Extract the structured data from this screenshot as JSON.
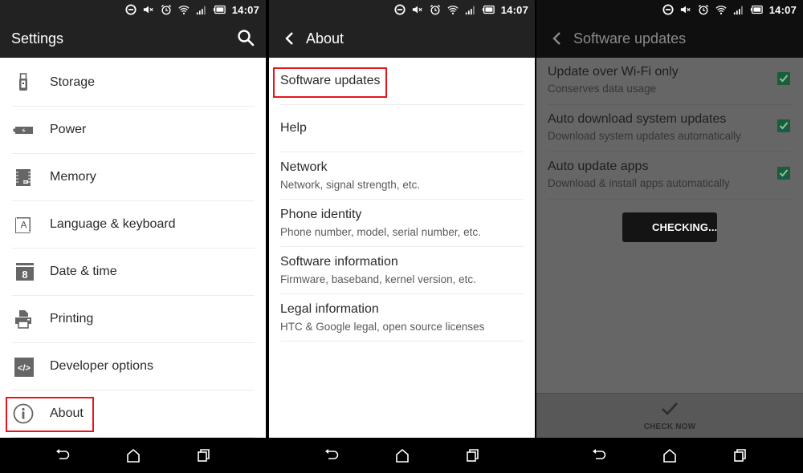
{
  "status_bar": {
    "time": "14:07",
    "icons": [
      "do-not-disturb-icon",
      "mute-icon",
      "alarm-icon",
      "wifi-icon",
      "signal-icon",
      "battery-icon"
    ]
  },
  "settings_screen": {
    "title": "Settings",
    "search_icon": "search-icon",
    "items": [
      {
        "label": "Storage",
        "icon": "usb-storage-icon"
      },
      {
        "label": "Power",
        "icon": "battery-power-icon"
      },
      {
        "label": "Memory",
        "icon": "memory-chip-icon"
      },
      {
        "label": "Language & keyboard",
        "icon": "language-keyboard-icon"
      },
      {
        "label": "Date & time",
        "icon": "calendar-icon",
        "icon_text": "8"
      },
      {
        "label": "Printing",
        "icon": "printer-icon"
      },
      {
        "label": "Developer options",
        "icon": "code-icon",
        "icon_text": "</>"
      },
      {
        "label": "About",
        "icon": "info-icon",
        "highlighted": true
      }
    ]
  },
  "about_screen": {
    "title": "About",
    "items": [
      {
        "title": "Software updates",
        "subtitle": "",
        "highlighted": true
      },
      {
        "title": "Help",
        "subtitle": ""
      },
      {
        "title": "Network",
        "subtitle": "Network, signal strength, etc."
      },
      {
        "title": "Phone identity",
        "subtitle": "Phone number, model, serial number, etc."
      },
      {
        "title": "Software information",
        "subtitle": "Firmware, baseband, kernel version, etc."
      },
      {
        "title": "Legal information",
        "subtitle": "HTC & Google legal, open source licenses"
      }
    ]
  },
  "software_updates_screen": {
    "title": "Software updates",
    "items": [
      {
        "title": "Update over Wi-Fi only",
        "subtitle": "Conserves data usage",
        "checked": true
      },
      {
        "title": "Auto download system updates",
        "subtitle": "Download system updates automatically",
        "checked": true
      },
      {
        "title": "Auto update apps",
        "subtitle": "Download & install apps automatically",
        "checked": true
      }
    ],
    "progress_dialog": {
      "label": "CHECKING..."
    },
    "check_now_label": "CHECK NOW"
  },
  "nav_bar": {
    "buttons": [
      "back",
      "home",
      "recents"
    ]
  },
  "colors": {
    "highlight_red": "#e8141c",
    "checkbox_green": "#1a5c3e",
    "app_bar": "#222222"
  }
}
